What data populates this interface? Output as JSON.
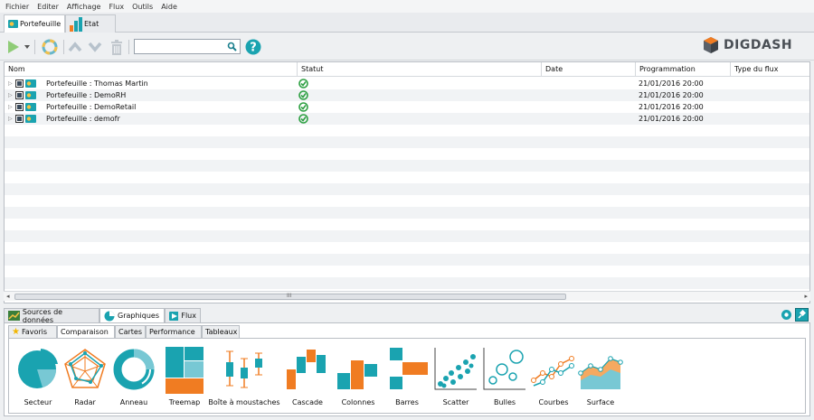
{
  "menu": [
    "Fichier",
    "Editer",
    "Affichage",
    "Flux",
    "Outils",
    "Aide"
  ],
  "top_tabs": [
    {
      "label": "Portefeuille",
      "active": true
    },
    {
      "label": "Etat",
      "active": false
    }
  ],
  "toolbar": {
    "search_value": "",
    "brand": "DIGDASH"
  },
  "table": {
    "columns": [
      "Nom",
      "Statut",
      "Date",
      "Programmation",
      "Type du flux"
    ],
    "rows": [
      {
        "name": "Portefeuille : Thomas Martin",
        "status": "ok",
        "date": "",
        "schedule": "21/01/2016 20:00",
        "type": ""
      },
      {
        "name": "Portefeuille : DemoRH",
        "status": "ok",
        "date": "",
        "schedule": "21/01/2016 20:00",
        "type": ""
      },
      {
        "name": "Portefeuille : DemoRetail",
        "status": "ok",
        "date": "",
        "schedule": "21/01/2016 20:00",
        "type": ""
      },
      {
        "name": "Portefeuille : demofr",
        "status": "ok",
        "date": "",
        "schedule": "21/01/2016 20:00",
        "type": ""
      }
    ]
  },
  "scroll_marker": "III",
  "bottom_tabs": [
    {
      "label": "Sources de données",
      "active": false
    },
    {
      "label": "Graphiques",
      "active": true
    },
    {
      "label": "Flux",
      "active": false
    }
  ],
  "sub_tabs": [
    {
      "label": "Favoris",
      "active": false
    },
    {
      "label": "Comparaison",
      "active": true
    },
    {
      "label": "Cartes",
      "active": false
    },
    {
      "label": "Performance",
      "active": false
    },
    {
      "label": "Tableaux",
      "active": false
    }
  ],
  "charts": [
    "Secteur",
    "Radar",
    "Anneau",
    "Treemap",
    "Boîte à moustaches",
    "Cascade",
    "Colonnes",
    "Barres",
    "Scatter",
    "Bulles",
    "Courbes",
    "Surface"
  ],
  "colors": {
    "teal": "#1aa3b0",
    "orange": "#f07c22",
    "green": "#3fa535",
    "check": "#2ea043"
  }
}
